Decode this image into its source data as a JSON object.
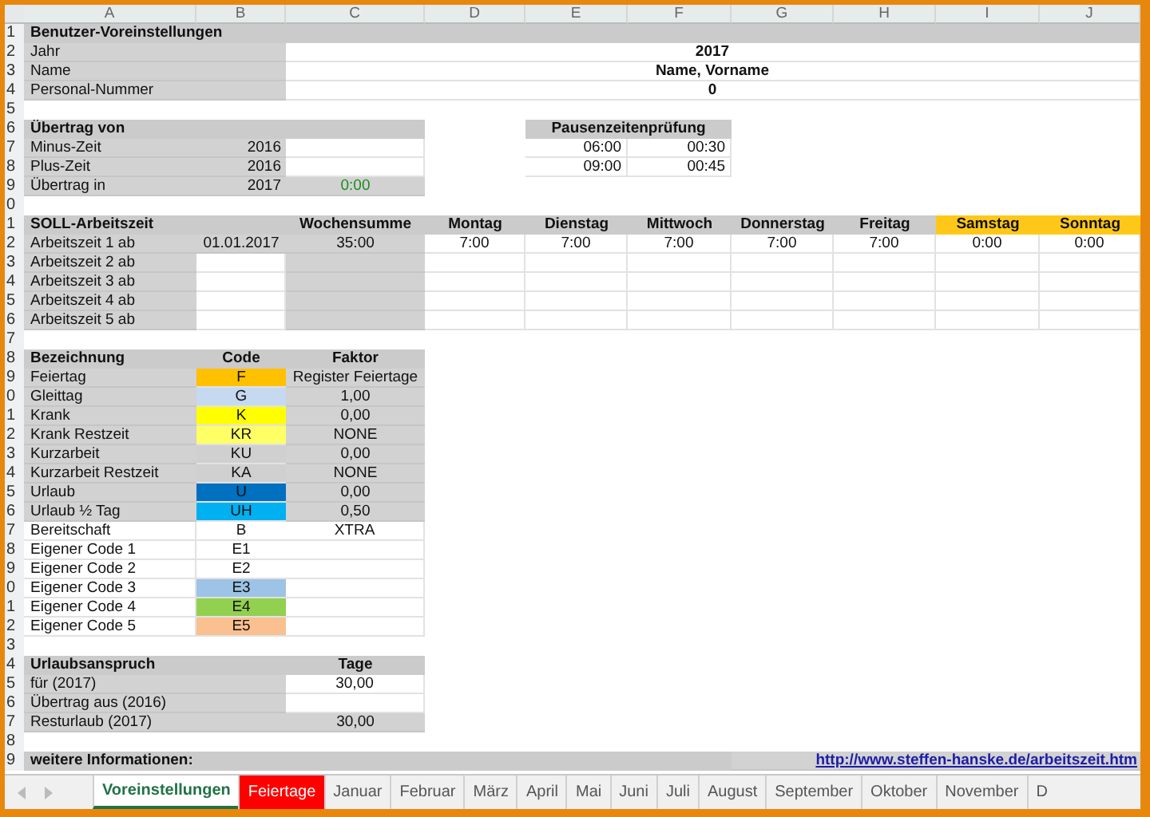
{
  "columns": [
    "A",
    "B",
    "C",
    "D",
    "E",
    "F",
    "G",
    "H",
    "I",
    "J"
  ],
  "rows": [
    {
      "num": "1",
      "cells": [
        {
          "kind": "header",
          "text": "Benutzer-Voreinstellungen"
        },
        {
          "kind": "merge"
        },
        {
          "kind": "merge"
        },
        {
          "kind": "merge"
        },
        {
          "kind": "merge"
        },
        {
          "kind": "merge"
        },
        {
          "kind": "merge"
        },
        {
          "kind": "merge"
        },
        {
          "kind": "merge"
        },
        {
          "kind": "merge"
        }
      ]
    },
    {
      "num": "2",
      "cells": [
        {
          "kind": "label",
          "text": "Jahr"
        },
        {
          "kind": "merge"
        },
        {
          "kind": "value-strong",
          "text": "2017"
        },
        {
          "kind": "merge"
        },
        {
          "kind": "merge"
        },
        {
          "kind": "merge"
        },
        {
          "kind": "merge"
        },
        {
          "kind": "merge"
        },
        {
          "kind": "merge"
        },
        {
          "kind": "merge"
        }
      ]
    },
    {
      "num": "3",
      "cells": [
        {
          "kind": "label",
          "text": "Name"
        },
        {
          "kind": "merge"
        },
        {
          "kind": "value-strong",
          "text": "Name, Vorname"
        },
        {
          "kind": "merge"
        },
        {
          "kind": "merge"
        },
        {
          "kind": "merge"
        },
        {
          "kind": "merge"
        },
        {
          "kind": "merge"
        },
        {
          "kind": "merge"
        },
        {
          "kind": "merge"
        }
      ]
    },
    {
      "num": "4",
      "cells": [
        {
          "kind": "label",
          "text": "Personal-Nummer"
        },
        {
          "kind": "merge"
        },
        {
          "kind": "value-strong",
          "text": "0"
        },
        {
          "kind": "merge"
        },
        {
          "kind": "merge"
        },
        {
          "kind": "merge"
        },
        {
          "kind": "merge"
        },
        {
          "kind": "merge"
        },
        {
          "kind": "merge"
        },
        {
          "kind": "merge"
        }
      ]
    },
    {
      "num": "5",
      "cells": []
    },
    {
      "num": "6",
      "cells": [
        {
          "kind": "header",
          "text": "Übertrag von"
        },
        {
          "kind": "merge"
        },
        {
          "kind": "merge"
        },
        {
          "kind": "blank"
        },
        {
          "kind": "header",
          "text": "Pausenzeitenprüfung"
        },
        {
          "kind": "merge"
        }
      ]
    },
    {
      "num": "7",
      "cells": [
        {
          "kind": "label",
          "text": "Minus-Zeit"
        },
        {
          "kind": "label-right",
          "text": "2016"
        },
        {
          "kind": "value"
        },
        {
          "kind": "blank"
        },
        {
          "kind": "value-right",
          "text": "06:00"
        },
        {
          "kind": "value-right",
          "text": "00:30"
        }
      ]
    },
    {
      "num": "8",
      "cells": [
        {
          "kind": "label",
          "text": "Plus-Zeit"
        },
        {
          "kind": "label-right",
          "text": "2016"
        },
        {
          "kind": "value"
        },
        {
          "kind": "blank"
        },
        {
          "kind": "value-right",
          "text": "09:00"
        },
        {
          "kind": "value-right",
          "text": "00:45"
        }
      ]
    },
    {
      "num": "9",
      "cells": [
        {
          "kind": "label",
          "text": "Übertrag in"
        },
        {
          "kind": "label-right",
          "text": "2017"
        },
        {
          "kind": "positive",
          "text": "0:00"
        }
      ]
    },
    {
      "num": "0",
      "cells": []
    },
    {
      "num": "1",
      "cells": [
        {
          "kind": "header",
          "text": "SOLL-Arbeitszeit"
        },
        {
          "kind": "merge"
        },
        {
          "kind": "header",
          "text": "Wochensumme"
        },
        {
          "kind": "header",
          "text": "Montag"
        },
        {
          "kind": "header",
          "text": "Dienstag"
        },
        {
          "kind": "header",
          "text": "Mittwoch"
        },
        {
          "kind": "header",
          "text": "Donnerstag"
        },
        {
          "kind": "header",
          "text": "Freitag"
        },
        {
          "kind": "weekend",
          "text": "Samstag"
        },
        {
          "kind": "weekend",
          "text": "Sonntag"
        }
      ]
    },
    {
      "num": "2",
      "cells": [
        {
          "kind": "label",
          "text": "Arbeitszeit 1 ab"
        },
        {
          "kind": "label",
          "text": "01.01.2017"
        },
        {
          "kind": "label",
          "text": "35:00"
        },
        {
          "kind": "value",
          "text": "7:00"
        },
        {
          "kind": "value",
          "text": "7:00"
        },
        {
          "kind": "value",
          "text": "7:00"
        },
        {
          "kind": "value",
          "text": "7:00"
        },
        {
          "kind": "value",
          "text": "7:00"
        },
        {
          "kind": "value",
          "text": "0:00"
        },
        {
          "kind": "value",
          "text": "0:00"
        }
      ]
    },
    {
      "num": "3",
      "cells": [
        {
          "kind": "label",
          "text": "Arbeitszeit 2 ab"
        },
        {
          "kind": "value"
        },
        {
          "kind": "label"
        },
        {
          "kind": "value"
        },
        {
          "kind": "value"
        },
        {
          "kind": "value"
        },
        {
          "kind": "value"
        },
        {
          "kind": "value"
        },
        {
          "kind": "value"
        },
        {
          "kind": "value"
        }
      ]
    },
    {
      "num": "4",
      "cells": [
        {
          "kind": "label",
          "text": "Arbeitszeit 3 ab"
        },
        {
          "kind": "value"
        },
        {
          "kind": "label"
        },
        {
          "kind": "value"
        },
        {
          "kind": "value"
        },
        {
          "kind": "value"
        },
        {
          "kind": "value"
        },
        {
          "kind": "value"
        },
        {
          "kind": "value"
        },
        {
          "kind": "value"
        }
      ]
    },
    {
      "num": "5",
      "cells": [
        {
          "kind": "label",
          "text": "Arbeitszeit 4 ab"
        },
        {
          "kind": "value"
        },
        {
          "kind": "label"
        },
        {
          "kind": "value"
        },
        {
          "kind": "value"
        },
        {
          "kind": "value"
        },
        {
          "kind": "value"
        },
        {
          "kind": "value"
        },
        {
          "kind": "value"
        },
        {
          "kind": "value"
        }
      ]
    },
    {
      "num": "6",
      "cells": [
        {
          "kind": "label",
          "text": "Arbeitszeit 5 ab"
        },
        {
          "kind": "value"
        },
        {
          "kind": "label"
        },
        {
          "kind": "value"
        },
        {
          "kind": "value"
        },
        {
          "kind": "value"
        },
        {
          "kind": "value"
        },
        {
          "kind": "value"
        },
        {
          "kind": "value"
        },
        {
          "kind": "value"
        }
      ]
    },
    {
      "num": "7",
      "cells": []
    },
    {
      "num": "8",
      "cells": [
        {
          "kind": "header",
          "text": "Bezeichnung"
        },
        {
          "kind": "header",
          "text": "Code"
        },
        {
          "kind": "header",
          "text": "Faktor"
        }
      ]
    },
    {
      "num": "9",
      "cells": [
        {
          "kind": "label",
          "text": "Feiertag"
        },
        {
          "kind": "code",
          "text": "F",
          "color": "#ffc000"
        },
        {
          "kind": "label",
          "text": "Register Feiertage"
        }
      ]
    },
    {
      "num": "0",
      "cells": [
        {
          "kind": "label",
          "text": "Gleittag"
        },
        {
          "kind": "code",
          "text": "G",
          "color": "#c5d9f1"
        },
        {
          "kind": "label",
          "text": "1,00"
        }
      ]
    },
    {
      "num": "1",
      "cells": [
        {
          "kind": "label",
          "text": "Krank"
        },
        {
          "kind": "code",
          "text": "K",
          "color": "#ffff00"
        },
        {
          "kind": "label",
          "text": "0,00"
        }
      ]
    },
    {
      "num": "2",
      "cells": [
        {
          "kind": "label",
          "text": "Krank Restzeit"
        },
        {
          "kind": "code",
          "text": "KR",
          "color": "#ffff66"
        },
        {
          "kind": "label",
          "text": "NONE"
        }
      ]
    },
    {
      "num": "3",
      "cells": [
        {
          "kind": "label",
          "text": "Kurzarbeit"
        },
        {
          "kind": "code",
          "text": "KU",
          "color": "#d0d0d0"
        },
        {
          "kind": "label",
          "text": "0,00"
        }
      ]
    },
    {
      "num": "4",
      "cells": [
        {
          "kind": "label",
          "text": "Kurzarbeit Restzeit"
        },
        {
          "kind": "code",
          "text": "KA",
          "color": "#d0d0d0"
        },
        {
          "kind": "label",
          "text": "NONE"
        }
      ]
    },
    {
      "num": "5",
      "cells": [
        {
          "kind": "label",
          "text": "Urlaub"
        },
        {
          "kind": "code",
          "text": "U",
          "color": "#0070c0"
        },
        {
          "kind": "label",
          "text": "0,00"
        }
      ]
    },
    {
      "num": "6",
      "cells": [
        {
          "kind": "label",
          "text": "Urlaub ½ Tag"
        },
        {
          "kind": "code",
          "text": "UH",
          "color": "#00b0f0"
        },
        {
          "kind": "label",
          "text": "0,50"
        }
      ]
    },
    {
      "num": "7",
      "cells": [
        {
          "kind": "value",
          "text": "Bereitschaft"
        },
        {
          "kind": "code",
          "text": "B",
          "color": "#ffffff"
        },
        {
          "kind": "value",
          "text": "XTRA"
        }
      ]
    },
    {
      "num": "8",
      "cells": [
        {
          "kind": "value",
          "text": "Eigener Code 1"
        },
        {
          "kind": "code",
          "text": "E1",
          "color": "#ffffff"
        },
        {
          "kind": "value"
        }
      ]
    },
    {
      "num": "9",
      "cells": [
        {
          "kind": "value",
          "text": "Eigener Code 2"
        },
        {
          "kind": "code",
          "text": "E2",
          "color": "#ffffff"
        },
        {
          "kind": "value"
        }
      ]
    },
    {
      "num": "0",
      "cells": [
        {
          "kind": "value",
          "text": "Eigener Code 3"
        },
        {
          "kind": "code",
          "text": "E3",
          "color": "#9dc3e6"
        },
        {
          "kind": "value"
        }
      ]
    },
    {
      "num": "1",
      "cells": [
        {
          "kind": "value",
          "text": "Eigener Code 4"
        },
        {
          "kind": "code",
          "text": "E4",
          "color": "#92d050"
        },
        {
          "kind": "value"
        }
      ]
    },
    {
      "num": "2",
      "cells": [
        {
          "kind": "value",
          "text": "Eigener Code 5"
        },
        {
          "kind": "code",
          "text": "E5",
          "color": "#fac090"
        },
        {
          "kind": "value"
        }
      ]
    },
    {
      "num": "3",
      "cells": []
    },
    {
      "num": "4",
      "cells": [
        {
          "kind": "header",
          "text": "Urlaubsanspruch"
        },
        {
          "kind": "merge"
        },
        {
          "kind": "header",
          "text": "Tage"
        }
      ]
    },
    {
      "num": "5",
      "cells": [
        {
          "kind": "label",
          "text": "für (2017)"
        },
        {
          "kind": "merge"
        },
        {
          "kind": "value",
          "text": "30,00"
        }
      ]
    },
    {
      "num": "6",
      "cells": [
        {
          "kind": "label",
          "text": "Übertrag aus (2016)"
        },
        {
          "kind": "merge"
        },
        {
          "kind": "value"
        }
      ]
    },
    {
      "num": "7",
      "cells": [
        {
          "kind": "label",
          "text": "Resturlaub (2017)"
        },
        {
          "kind": "merge"
        },
        {
          "kind": "label",
          "text": "30,00"
        }
      ]
    },
    {
      "num": "8",
      "cells": []
    },
    {
      "num": "9",
      "cells": [
        {
          "kind": "header",
          "text": "weitere Informationen:"
        },
        {
          "kind": "merge"
        },
        {
          "kind": "merge"
        },
        {
          "kind": "merge"
        },
        {
          "kind": "merge"
        },
        {
          "kind": "merge"
        },
        {
          "kind": "link",
          "text": "http://www.steffen-hanske.de/arbeitszeit.htm"
        },
        {
          "kind": "merge"
        },
        {
          "kind": "merge"
        },
        {
          "kind": "merge"
        }
      ]
    }
  ],
  "tabs": [
    {
      "label": "Voreinstellungen",
      "selected": true
    },
    {
      "label": "Feiertage",
      "selected": false,
      "color": "#ff0000"
    },
    {
      "label": "Januar",
      "selected": false
    },
    {
      "label": "Februar",
      "selected": false
    },
    {
      "label": "März",
      "selected": false
    },
    {
      "label": "April",
      "selected": false
    },
    {
      "label": "Mai",
      "selected": false
    },
    {
      "label": "Juni",
      "selected": false
    },
    {
      "label": "Juli",
      "selected": false
    },
    {
      "label": "August",
      "selected": false
    },
    {
      "label": "September",
      "selected": false
    },
    {
      "label": "Oktober",
      "selected": false
    },
    {
      "label": "November",
      "selected": false
    },
    {
      "label": "D",
      "selected": false
    }
  ]
}
